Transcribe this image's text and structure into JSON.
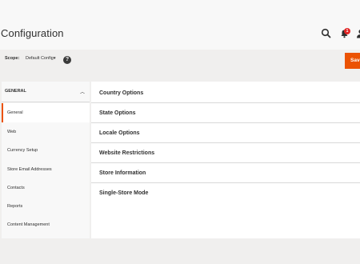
{
  "header": {
    "title": "Configuration",
    "notification_count": "1",
    "icons": [
      "search-icon",
      "bell-icon",
      "user-icon"
    ]
  },
  "scope": {
    "label": "Scope:",
    "value": "Default Config",
    "help": "?"
  },
  "actions": {
    "save_label": "Save"
  },
  "sidebar": {
    "section_title": "GENERAL",
    "items": [
      {
        "label": "General"
      },
      {
        "label": "Web"
      },
      {
        "label": "Currency Setup"
      },
      {
        "label": "Store Email Addresses"
      },
      {
        "label": "Contacts"
      },
      {
        "label": "Reports"
      },
      {
        "label": "Content Management"
      }
    ]
  },
  "main": {
    "sections": [
      {
        "label": "Country Options"
      },
      {
        "label": "State Options"
      },
      {
        "label": "Locale Options"
      },
      {
        "label": "Website Restrictions"
      },
      {
        "label": "Store Information"
      },
      {
        "label": "Single-Store Mode"
      }
    ]
  },
  "colors": {
    "accent": "#eb5202",
    "badge": "#e22626"
  }
}
